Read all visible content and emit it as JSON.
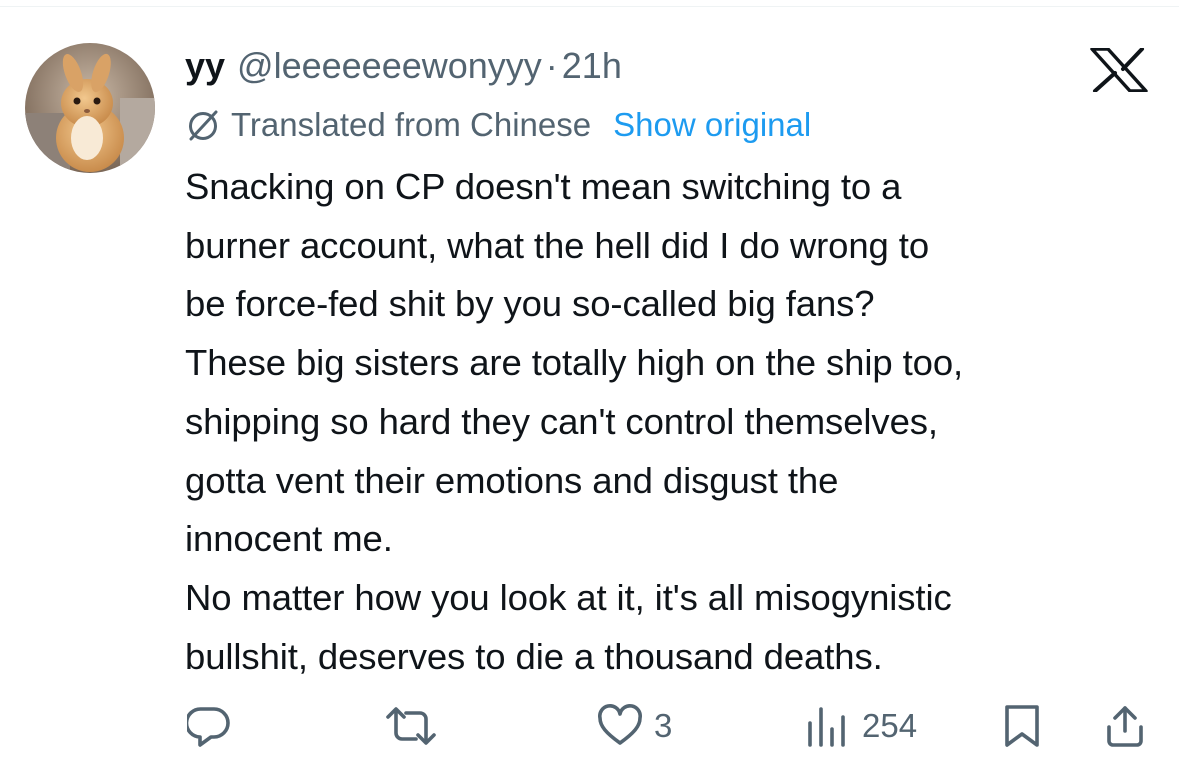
{
  "tweet": {
    "display_name": "yy",
    "handle": "@leeeeeeewonyyy",
    "separator": "·",
    "time": "21h",
    "translation_notice": "Translated from Chinese",
    "show_original_label": "Show original",
    "text_lines": [
      "Snacking on CP doesn't mean switching to a",
      "burner account, what the hell did I do wrong to",
      "be force-fed shit by you so-called big fans?",
      "These big sisters are totally high on the ship too,",
      "shipping so hard they can't control themselves,",
      "gotta vent their emotions and disgust the",
      "innocent me.",
      "No matter how you look at it, it's all misogynistic",
      "bullshit, deserves to die a thousand deaths."
    ]
  },
  "actions": {
    "reply": {
      "icon": "reply-icon",
      "count": ""
    },
    "retweet": {
      "icon": "retweet-icon",
      "count": ""
    },
    "like": {
      "icon": "heart-icon",
      "count": "3"
    },
    "views": {
      "icon": "views-icon",
      "count": "254"
    },
    "bookmark": {
      "icon": "bookmark-icon"
    },
    "share": {
      "icon": "share-icon"
    }
  },
  "colors": {
    "text": "#0f1419",
    "secondary": "#536471",
    "link": "#1d9bf0",
    "background": "#ffffff"
  }
}
